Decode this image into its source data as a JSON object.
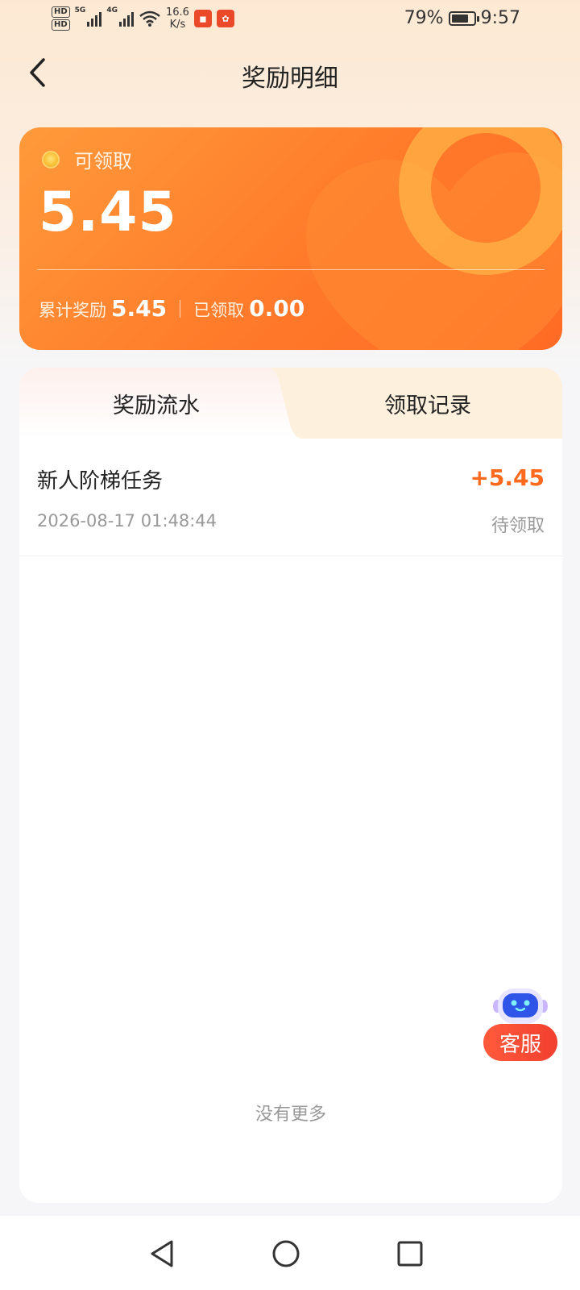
{
  "status_bar": {
    "network_1": "5G",
    "network_2": "4G",
    "hd_1": "HD",
    "hd_2": "HD",
    "speed_value": "16.6",
    "speed_unit": "K/s",
    "battery_percent": "79%",
    "battery_level": 0.79,
    "time": "9:57"
  },
  "header": {
    "title": "奖励明细"
  },
  "reward_card": {
    "available_label": "可领取",
    "available_amount": "5.45",
    "total_label": "累计奖励",
    "total_value": "5.45",
    "claimed_label": "已领取",
    "claimed_value": "0.00"
  },
  "tabs": [
    {
      "label": "奖励流水",
      "active": true
    },
    {
      "label": "领取记录",
      "active": false
    }
  ],
  "records": [
    {
      "title": "新人阶梯任务",
      "time": "2026-08-17 01:48:44",
      "amount": "+5.45",
      "status": "待领取"
    }
  ],
  "list_footer": "没有更多",
  "customer_service": {
    "label": "客服",
    "icon": "robot-icon"
  },
  "colors": {
    "accent": "#ff6a1f",
    "card_start": "#ff9a3a",
    "card_end": "#ff6a24",
    "cs_button": "#f2402f"
  }
}
